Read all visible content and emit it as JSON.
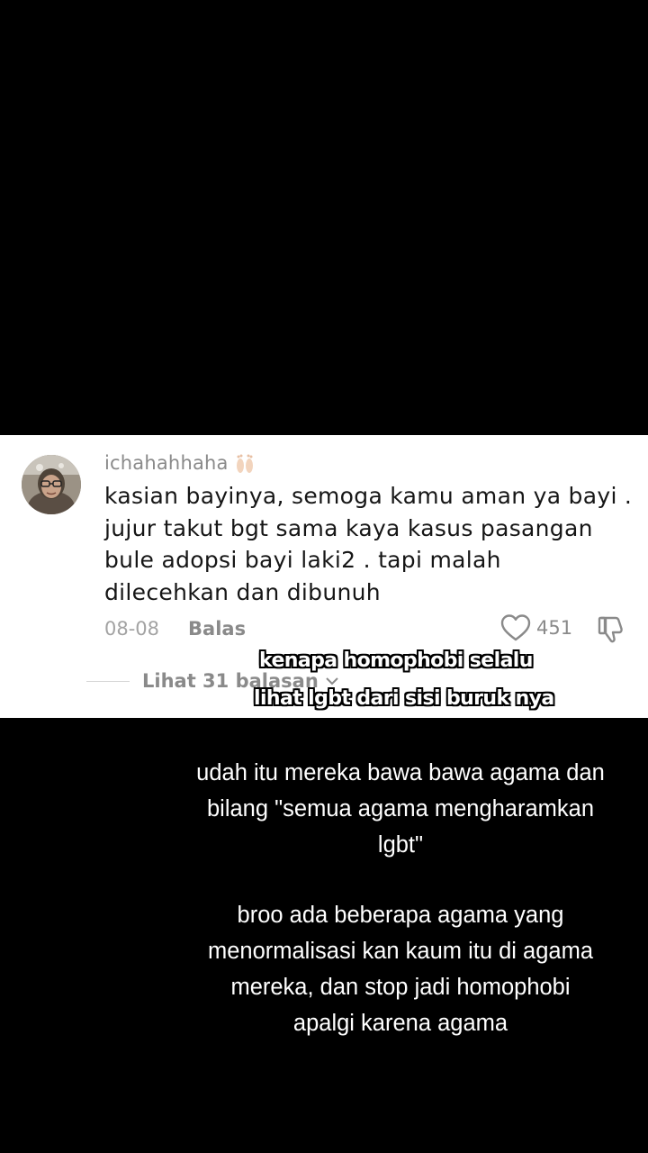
{
  "comment": {
    "username": "ichahahhaha",
    "username_emoji_icon": "feet-icon",
    "text_lines": [
      "kasian bayinya, semoga kamu aman ya bayi .",
      "jujur takut bgt sama kaya kasus pasangan",
      "bule adopsi bayi laki2 . tapi malah",
      "dilecehkan dan dibunuh"
    ],
    "date": "08-08",
    "reply_label": "Balas",
    "like_count": "451",
    "view_replies_label": "Lihat 31 balasan"
  },
  "stickers": {
    "line1": "kenapa homophobi selalu",
    "line2": "lihat lgbt dari sisi buruk nya"
  },
  "caption": {
    "para1": [
      "udah itu mereka bawa bawa agama dan",
      "bilang \"semua agama mengharamkan",
      "lgbt\""
    ],
    "para2": [
      "broo ada beberapa agama yang",
      "menormalisasi kan kaum itu di agama",
      "mereka, dan stop jadi homophobi",
      "apalgi karena agama"
    ]
  }
}
